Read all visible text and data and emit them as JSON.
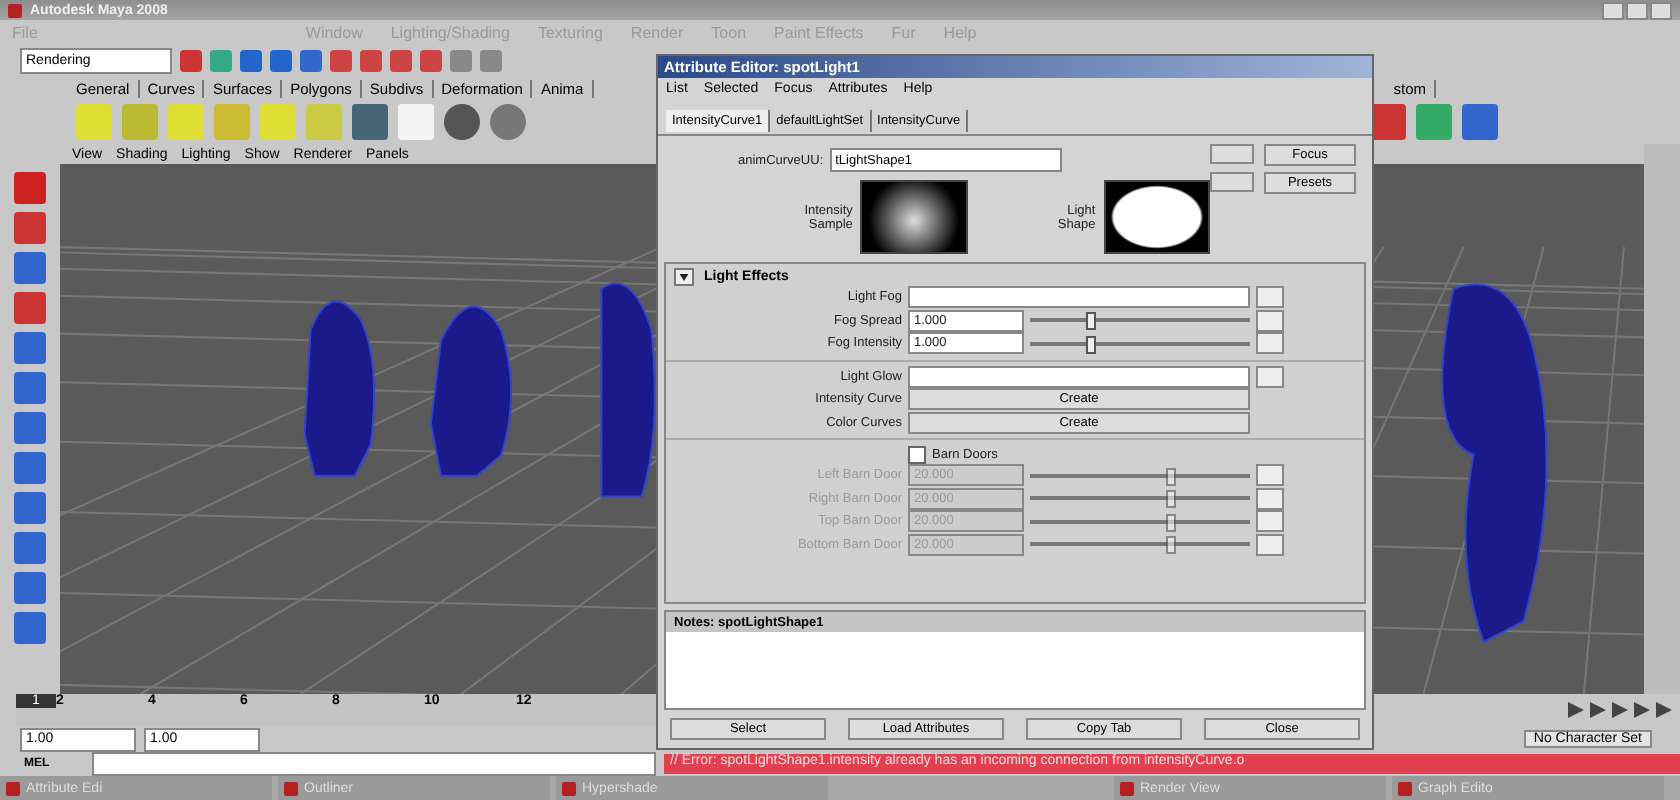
{
  "main_window": {
    "title": "Autodesk Maya 2008"
  },
  "menu": [
    "File",
    "Window",
    "Lighting/Shading",
    "Texturing",
    "Render",
    "Toon",
    "Paint Effects",
    "Fur",
    "Help"
  ],
  "menu_set": "Rendering",
  "shelf_tabs": [
    {
      "label": "General",
      "selected": false
    },
    {
      "label": "Curves",
      "selected": false
    },
    {
      "label": "Surfaces",
      "selected": false
    },
    {
      "label": "Polygons",
      "selected": false
    },
    {
      "label": "Subdivs",
      "selected": false
    },
    {
      "label": "Deformation",
      "selected": false
    },
    {
      "label": "Anima",
      "selected": false
    }
  ],
  "shelf_tab_right": "stom",
  "panel_menu": [
    "View",
    "Shading",
    "Lighting",
    "Show",
    "Renderer",
    "Panels"
  ],
  "attribute_editor": {
    "title": "Attribute Editor: spotLight1",
    "menu": [
      "List",
      "Selected",
      "Focus",
      "Attributes",
      "Help"
    ],
    "tabs": [
      {
        "label": "IntensityCurve1",
        "selected": true
      },
      {
        "label": "defaultLightSet",
        "selected": false
      },
      {
        "label": "IntensityCurve",
        "selected": false
      }
    ],
    "node_label": "animCurveUU:",
    "node_value": "tLightShape1",
    "buttons": [
      "Focus",
      "Presets"
    ],
    "swatch_labels": [
      "Intensity Sample",
      "Light Shape"
    ],
    "section": {
      "title": "Light Effects",
      "expanded": true
    },
    "rows": [
      {
        "kind": "map",
        "label": "Light Fog",
        "disabled": false
      },
      {
        "kind": "slider",
        "label": "Fog Spread",
        "value": "1.000",
        "level": 0.25,
        "disabled": false
      },
      {
        "kind": "slider",
        "label": "Fog Intensity",
        "value": "1.000",
        "level": 0.25,
        "disabled": false
      },
      {
        "kind": "divider"
      },
      {
        "kind": "map",
        "label": "Light Glow",
        "disabled": false
      },
      {
        "kind": "button",
        "label": "Intensity Curve",
        "button": "Create",
        "disabled": false
      },
      {
        "kind": "button",
        "label": "Color Curves",
        "button": "Create",
        "disabled": false
      },
      {
        "kind": "divider"
      },
      {
        "kind": "checkbox",
        "label": "Barn Doors",
        "checked": false
      },
      {
        "kind": "slider",
        "label": "Left Barn Door",
        "value": "20.000",
        "level": 0.62,
        "disabled": true
      },
      {
        "kind": "slider",
        "label": "Right Barn Door",
        "value": "20.000",
        "level": 0.62,
        "disabled": true
      },
      {
        "kind": "slider",
        "label": "Top Barn Door",
        "value": "20.000",
        "level": 0.62,
        "disabled": true
      },
      {
        "kind": "slider",
        "label": "Bottom Barn Door",
        "value": "20.000",
        "level": 0.62,
        "disabled": true
      }
    ],
    "notes_title": "Notes:  spotLightShape1",
    "bottom_buttons": [
      "Select",
      "Load Attributes",
      "Copy Tab",
      "Close"
    ]
  },
  "timeline": {
    "frames": [
      {
        "label": "1",
        "selected": true
      },
      {
        "label": "2",
        "selected": false
      },
      {
        "label": "4",
        "selected": false
      },
      {
        "label": "6",
        "selected": false
      },
      {
        "label": "8",
        "selected": false
      },
      {
        "label": "10",
        "selected": false
      },
      {
        "label": "12",
        "selected": false
      }
    ]
  },
  "range": {
    "start": "1.00",
    "end": "1.00"
  },
  "command": {
    "label": "MEL",
    "error": "// Error: spotLightShape1.intensity already has an incoming connection from intensityCurve.o"
  },
  "character_set": "No Character Set",
  "taskbar": [
    "Attribute Edi",
    "Outliner",
    "Hypershade",
    "Render View",
    "Graph Edito"
  ]
}
